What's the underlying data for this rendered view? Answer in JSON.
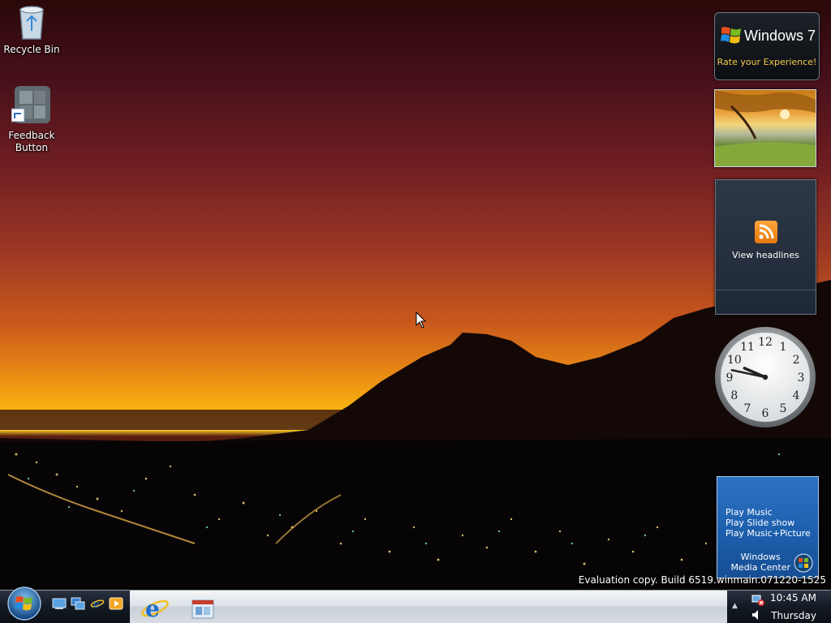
{
  "desktop": {
    "icons": [
      {
        "label": "Recycle Bin",
        "icon": "recycle-bin-icon"
      },
      {
        "label": "Feedback Button",
        "icon": "feedback-icon"
      }
    ],
    "evaluation_text": "Evaluation copy. Build 6519.winmain.071220-1525"
  },
  "gadgets": {
    "windows7": {
      "title": "Windows 7",
      "subtitle": "Rate your Experience!"
    },
    "slideshow": {
      "icon": "autumn-tree-photo"
    },
    "feed": {
      "label": "View headlines",
      "icon": "rss-icon"
    },
    "clock": {
      "numbers": [
        "12",
        "1",
        "2",
        "3",
        "4",
        "5",
        "6",
        "7",
        "8",
        "9",
        "10",
        "11"
      ],
      "hour": 9,
      "minute": 47
    },
    "media_center": {
      "items": [
        "Play Music",
        "Play Slide show",
        "Play Music+Picture"
      ],
      "brand_line1": "Windows",
      "brand_line2": "Media Center"
    }
  },
  "taskbar": {
    "start_icon": "windows-orb-icon",
    "quick_launch": [
      "show-desktop-icon",
      "switch-windows-icon",
      "internet-explorer-icon",
      "media-player-icon"
    ],
    "buttons": [
      "internet-explorer-icon",
      "windows-explorer-icon"
    ],
    "tray": {
      "time": "10:45 AM",
      "day": "Thursday",
      "icons": [
        "network-warning-icon",
        "volume-icon"
      ]
    }
  },
  "colors": {
    "accent": "#1d5fad",
    "taskbar_dark": "#141a24",
    "gold": "#f2c84b"
  }
}
